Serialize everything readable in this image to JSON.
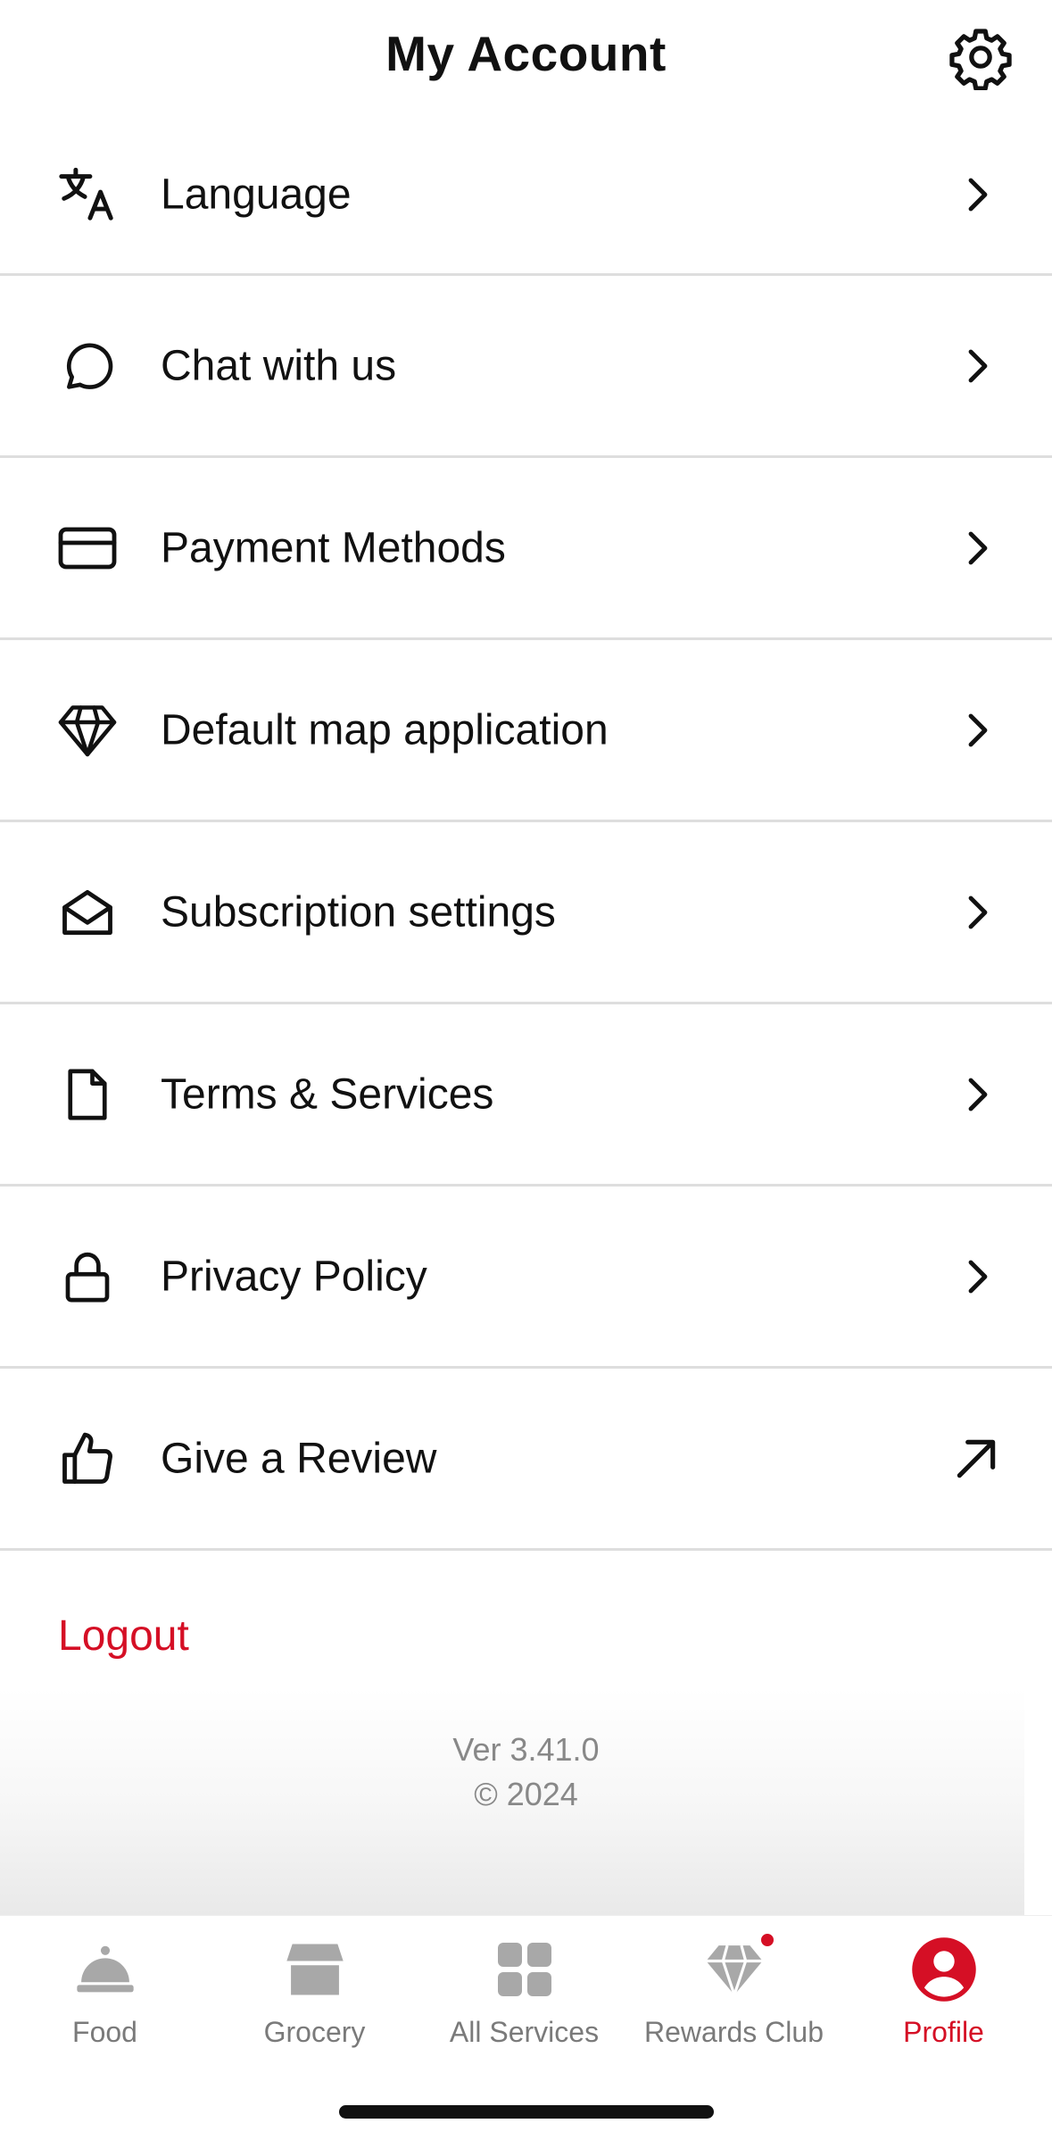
{
  "header": {
    "title": "My Account",
    "settings_icon": "gear-icon"
  },
  "menu": {
    "items": [
      {
        "label": "Language",
        "icon": "translate-icon",
        "action_icon": "chevron-right-icon"
      },
      {
        "label": "Chat with us",
        "icon": "chat-bubble-icon",
        "action_icon": "chevron-right-icon"
      },
      {
        "label": "Payment Methods",
        "icon": "credit-card-icon",
        "action_icon": "chevron-right-icon"
      },
      {
        "label": "Default map application",
        "icon": "diamond-icon",
        "action_icon": "chevron-right-icon"
      },
      {
        "label": "Subscription settings",
        "icon": "open-envelope-icon",
        "action_icon": "chevron-right-icon"
      },
      {
        "label": "Terms & Services",
        "icon": "document-icon",
        "action_icon": "chevron-right-icon"
      },
      {
        "label": "Privacy Policy",
        "icon": "lock-icon",
        "action_icon": "chevron-right-icon"
      },
      {
        "label": "Give a Review",
        "icon": "thumbs-up-icon",
        "action_icon": "external-arrow-icon"
      }
    ]
  },
  "logout": {
    "label": "Logout"
  },
  "footer": {
    "version": "Ver 3.41.0",
    "copyright": "© 2024"
  },
  "tabbar": {
    "tabs": [
      {
        "label": "Food",
        "icon": "cloche-icon",
        "active": false
      },
      {
        "label": "Grocery",
        "icon": "storefront-icon",
        "active": false
      },
      {
        "label": "All Services",
        "icon": "grid-icon",
        "active": false
      },
      {
        "label": "Rewards Club",
        "icon": "diamond-icon",
        "active": false,
        "badge": true
      },
      {
        "label": "Profile",
        "icon": "user-circle-icon",
        "active": true
      }
    ]
  },
  "colors": {
    "accent": "#d50f25",
    "text": "#111111",
    "muted": "#888888",
    "divider": "#dedede",
    "tab_inactive": "#7a7a7a"
  }
}
